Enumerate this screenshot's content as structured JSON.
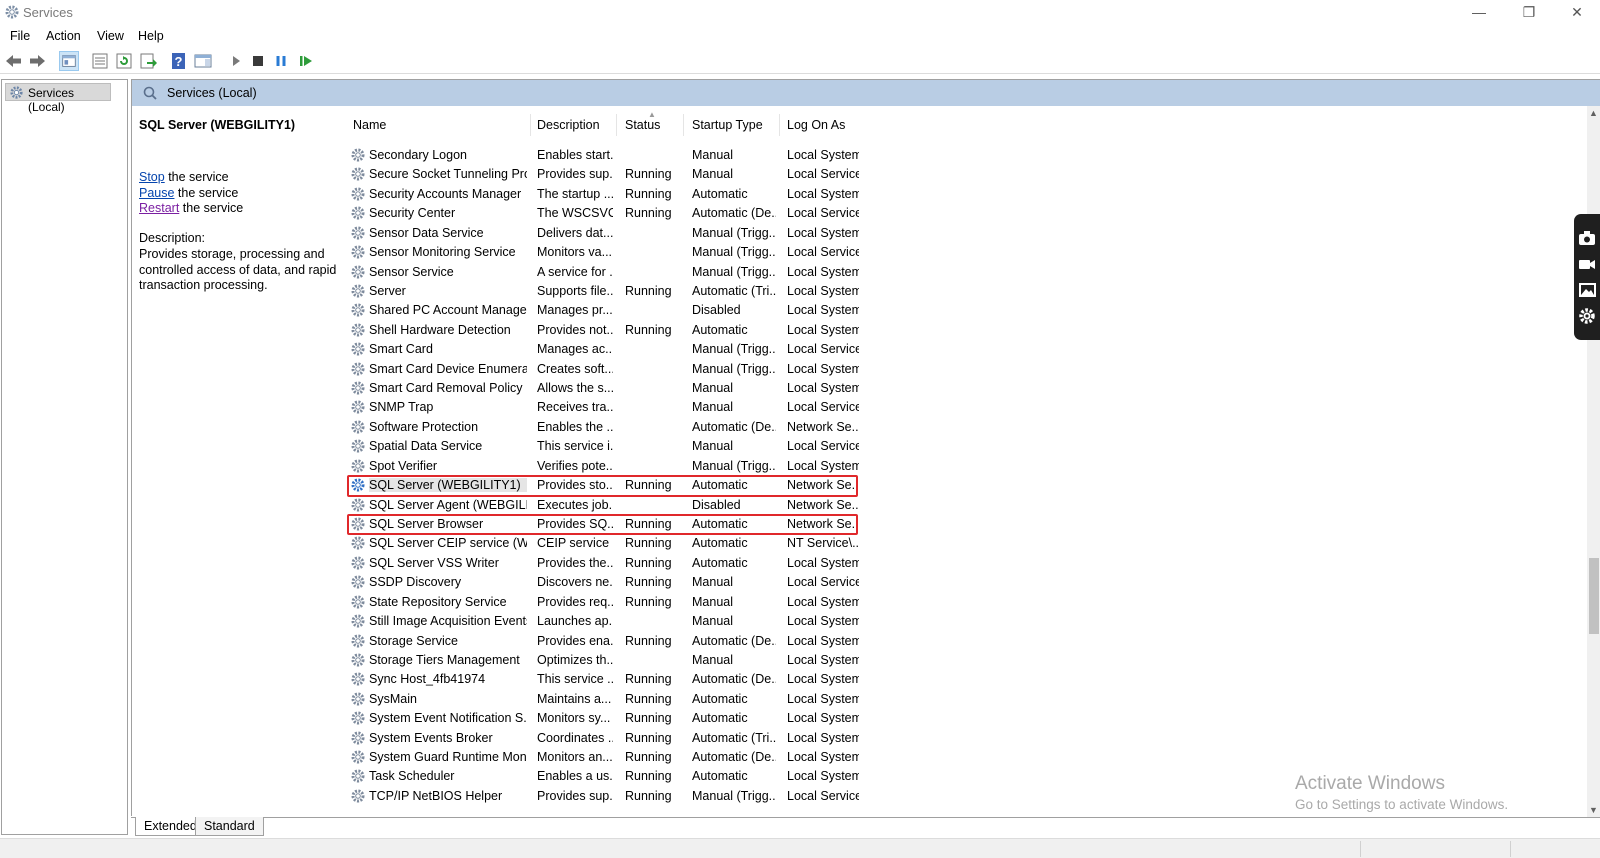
{
  "window": {
    "title": "Services",
    "minimize_glyph": "—",
    "restore_glyph": "❐",
    "close_glyph": "✕"
  },
  "menu": [
    "File",
    "Action",
    "View",
    "Help"
  ],
  "toolbar_icons": [
    "back-icon",
    "forward-icon",
    "show-console-tree-icon",
    "properties-icon",
    "refresh-icon",
    "export-list-icon",
    "help-icon",
    "show-action-pane-icon",
    "start-service-icon",
    "stop-service-icon",
    "pause-service-icon",
    "resume-service-icon"
  ],
  "tree": {
    "root_label": "Services (Local)"
  },
  "panel": {
    "header_title": "Services (Local)"
  },
  "details": {
    "service_title": "SQL Server (WEBGILITY1)",
    "actions": [
      {
        "link": "Stop",
        "suffix": " the service"
      },
      {
        "link": "Pause",
        "suffix": " the service"
      },
      {
        "link": "Restart",
        "suffix": " the service"
      }
    ],
    "description_label": "Description:",
    "description_text": "Provides storage, processing and controlled access of data, and rapid transaction processing."
  },
  "columns": [
    "Name",
    "Description",
    "Status",
    "Startup Type",
    "Log On As"
  ],
  "services": [
    {
      "name": "Secondary Logon",
      "description": "Enables start...",
      "status": "",
      "startup": "Manual",
      "logon": "Local System"
    },
    {
      "name": "Secure Socket Tunneling Pro...",
      "description": "Provides sup...",
      "status": "Running",
      "startup": "Manual",
      "logon": "Local Service"
    },
    {
      "name": "Security Accounts Manager",
      "description": "The startup ...",
      "status": "Running",
      "startup": "Automatic",
      "logon": "Local System"
    },
    {
      "name": "Security Center",
      "description": "The WSCSVC...",
      "status": "Running",
      "startup": "Automatic (De...",
      "logon": "Local Service"
    },
    {
      "name": "Sensor Data Service",
      "description": "Delivers dat...",
      "status": "",
      "startup": "Manual (Trigg...",
      "logon": "Local System"
    },
    {
      "name": "Sensor Monitoring Service",
      "description": "Monitors va...",
      "status": "",
      "startup": "Manual (Trigg...",
      "logon": "Local Service"
    },
    {
      "name": "Sensor Service",
      "description": "A service for ...",
      "status": "",
      "startup": "Manual (Trigg...",
      "logon": "Local System"
    },
    {
      "name": "Server",
      "description": "Supports file...",
      "status": "Running",
      "startup": "Automatic (Tri...",
      "logon": "Local System"
    },
    {
      "name": "Shared PC Account Manager",
      "description": "Manages pr...",
      "status": "",
      "startup": "Disabled",
      "logon": "Local System"
    },
    {
      "name": "Shell Hardware Detection",
      "description": "Provides not...",
      "status": "Running",
      "startup": "Automatic",
      "logon": "Local System"
    },
    {
      "name": "Smart Card",
      "description": "Manages ac...",
      "status": "",
      "startup": "Manual (Trigg...",
      "logon": "Local Service"
    },
    {
      "name": "Smart Card Device Enumerat...",
      "description": "Creates soft...",
      "status": "",
      "startup": "Manual (Trigg...",
      "logon": "Local System"
    },
    {
      "name": "Smart Card Removal Policy",
      "description": "Allows the s...",
      "status": "",
      "startup": "Manual",
      "logon": "Local System"
    },
    {
      "name": "SNMP Trap",
      "description": "Receives tra...",
      "status": "",
      "startup": "Manual",
      "logon": "Local Service"
    },
    {
      "name": "Software Protection",
      "description": "Enables the ...",
      "status": "",
      "startup": "Automatic (De...",
      "logon": "Network Se..."
    },
    {
      "name": "Spatial Data Service",
      "description": "This service i...",
      "status": "",
      "startup": "Manual",
      "logon": "Local Service"
    },
    {
      "name": "Spot Verifier",
      "description": "Verifies pote...",
      "status": "",
      "startup": "Manual (Trigg...",
      "logon": "Local System"
    },
    {
      "name": "SQL Server (WEBGILITY1)",
      "description": "Provides sto...",
      "status": "Running",
      "startup": "Automatic",
      "logon": "Network Se..."
    },
    {
      "name": "SQL Server Agent (WEBGILIT...",
      "description": "Executes job...",
      "status": "",
      "startup": "Disabled",
      "logon": "Network Se..."
    },
    {
      "name": "SQL Server Browser",
      "description": "Provides SQ...",
      "status": "Running",
      "startup": "Automatic",
      "logon": "Network Se..."
    },
    {
      "name": "SQL Server CEIP service (WEB...",
      "description": "CEIP service ...",
      "status": "Running",
      "startup": "Automatic",
      "logon": "NT Service\\..."
    },
    {
      "name": "SQL Server VSS Writer",
      "description": "Provides the...",
      "status": "Running",
      "startup": "Automatic",
      "logon": "Local System"
    },
    {
      "name": "SSDP Discovery",
      "description": "Discovers ne...",
      "status": "Running",
      "startup": "Manual",
      "logon": "Local Service"
    },
    {
      "name": "State Repository Service",
      "description": "Provides req...",
      "status": "Running",
      "startup": "Manual",
      "logon": "Local System"
    },
    {
      "name": "Still Image Acquisition Events",
      "description": "Launches ap...",
      "status": "",
      "startup": "Manual",
      "logon": "Local System"
    },
    {
      "name": "Storage Service",
      "description": "Provides ena...",
      "status": "Running",
      "startup": "Automatic (De...",
      "logon": "Local System"
    },
    {
      "name": "Storage Tiers Management",
      "description": "Optimizes th...",
      "status": "",
      "startup": "Manual",
      "logon": "Local System"
    },
    {
      "name": "Sync Host_4fb41974",
      "description": "This service ...",
      "status": "Running",
      "startup": "Automatic (De...",
      "logon": "Local System"
    },
    {
      "name": "SysMain",
      "description": "Maintains a...",
      "status": "Running",
      "startup": "Automatic",
      "logon": "Local System"
    },
    {
      "name": "System Event Notification S...",
      "description": "Monitors sy...",
      "status": "Running",
      "startup": "Automatic",
      "logon": "Local System"
    },
    {
      "name": "System Events Broker",
      "description": "Coordinates ...",
      "status": "Running",
      "startup": "Automatic (Tri...",
      "logon": "Local System"
    },
    {
      "name": "System Guard Runtime Mon...",
      "description": "Monitors an...",
      "status": "Running",
      "startup": "Automatic (De...",
      "logon": "Local System"
    },
    {
      "name": "Task Scheduler",
      "description": "Enables a us...",
      "status": "Running",
      "startup": "Automatic",
      "logon": "Local System"
    },
    {
      "name": "TCP/IP NetBIOS Helper",
      "description": "Provides sup...",
      "status": "Running",
      "startup": "Manual (Trigg...",
      "logon": "Local Service"
    }
  ],
  "selected_service": "SQL Server (WEBGILITY1)",
  "highlighted_services": [
    "SQL Server (WEBGILITY1)",
    "SQL Server Browser"
  ],
  "highlight_color": "#e0282b",
  "tabs": [
    "Extended",
    "Standard"
  ],
  "watermark": {
    "line1": "Activate Windows",
    "line2": "Go to Settings to activate Windows."
  },
  "capture_widget_icons": [
    "camera-icon",
    "video-icon",
    "gallery-icon",
    "settings-gear-icon"
  ]
}
